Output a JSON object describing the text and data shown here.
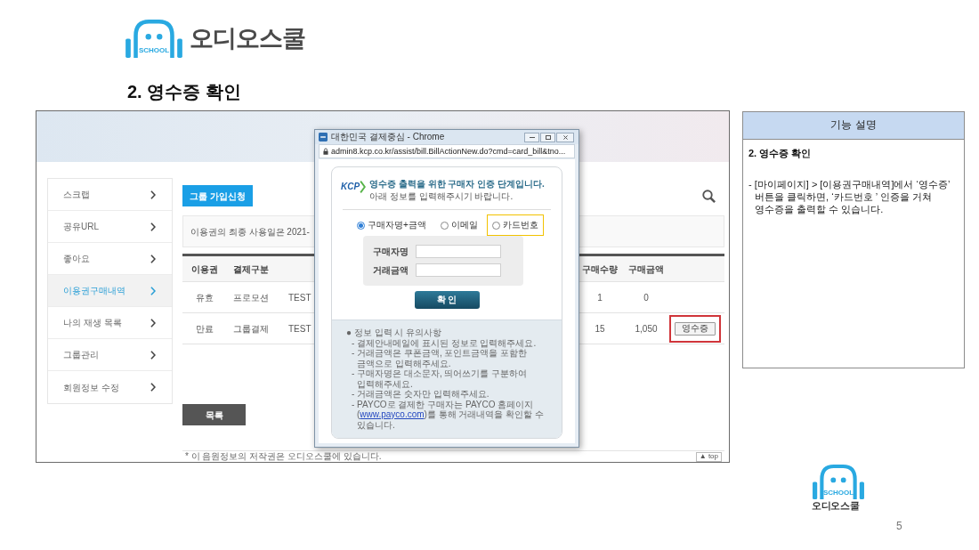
{
  "header": {
    "logo": {
      "badge": "SCHOOL",
      "name": "오디오스쿨"
    },
    "title": "2. 영수증 확인"
  },
  "screenshot": {
    "sidebar": {
      "items": [
        {
          "label": "스크랩",
          "selected": false
        },
        {
          "label": "공유URL",
          "selected": false
        },
        {
          "label": "좋아요",
          "selected": false
        },
        {
          "label": "이용권구매내역",
          "selected": true
        },
        {
          "label": "나의 재생 목록",
          "selected": false
        },
        {
          "label": "그룹관리",
          "selected": false
        },
        {
          "label": "회원정보 수정",
          "selected": false
        }
      ]
    },
    "join_button": "그룹 가입신청",
    "notice": "이용권의 최종 사용일은 2021-",
    "table": {
      "columns": {
        "ticket": "이용권",
        "payment_type": "결제구분",
        "quantity": "구매수량",
        "amount": "구매금액"
      },
      "rows": [
        {
          "ticket": "유효",
          "payment_type": "프로모션",
          "column_3": "TEST",
          "quantity": "1",
          "amount": "0"
        },
        {
          "ticket": "만료",
          "payment_type": "그룹결제",
          "column_3": "TEST",
          "quantity": "15",
          "amount": "1,050",
          "receipt_button": {
            "label": "영수증",
            "highlighted": true
          }
        }
      ]
    },
    "list_button": "목록",
    "footer": "* 이 음원정보의 저작권은 오디오스쿨에 있습니다.",
    "top_button": "▲ top",
    "popup": {
      "title": "대한민국 결제중심 - Chrome",
      "url": "admin8.kcp.co.kr/assist/bill.BillActionNew.do?cmd=card_bill&tno...",
      "logo": "KCP",
      "heading": "영수증 출력을 위한 구매자 인증 단계입니다.",
      "subheading": "아래 정보를 입력해주시기 바랍니다.",
      "options": [
        {
          "label": "구매자명+금액",
          "selected": true,
          "highlighted": false
        },
        {
          "label": "이메일",
          "selected": false,
          "highlighted": false
        },
        {
          "label": "카드번호",
          "selected": false,
          "highlighted": true
        }
      ],
      "fields": [
        {
          "label": "구매자명"
        },
        {
          "label": "거래금액"
        }
      ],
      "confirm_button": "확 인",
      "notes_title": "● 정보 입력 시 유의사항",
      "notes": [
        "- 결제안내메일에 표시된 정보로 입력해주세요.",
        "- 거래금액은 쿠폰금액, 포인트금액을 포함한 금액으로 입력해주세요.",
        "- 구매자명은 대소문자, 띄어쓰기를 구분하여 입력해주세요.",
        "- 거래금액은 숫자만 입력해주세요."
      ],
      "payco_note": {
        "before": "- PAYCO로 결제한 구매자는 PAYCO 홈페이지(",
        "link": "www.payco.com",
        "after": ")를 통해 거래내역을 확인할 수 있습니다."
      }
    }
  },
  "panel": {
    "header": "기능 설명",
    "subtitle": "2. 영수증 확인",
    "description": "- [마이페이지] > [이용권구매내역]에서 ‘영수증’ 버튼을 클릭하면, ‘카드번호 ’ 인증을 거쳐 영수증을 출력할 수 있습니다."
  },
  "footer_logo": {
    "badge": "SCHOOL",
    "name": "오디오스쿨"
  },
  "page_number": "5"
}
